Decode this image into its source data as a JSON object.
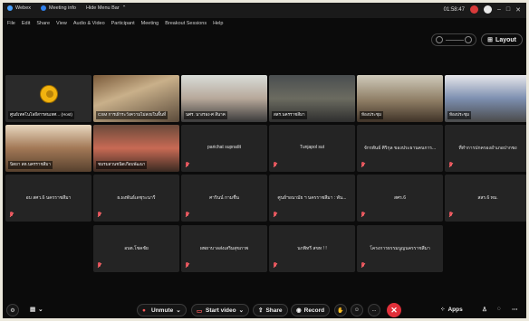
{
  "titlebar": {
    "app": "Webex",
    "meeting_info": "Meeting info",
    "hide_menu": "Hide Menu Bar",
    "timer": "01:58:47"
  },
  "menu": [
    "File",
    "Edit",
    "Share",
    "View",
    "Audio & Video",
    "Participant",
    "Meeting",
    "Breakout Sessions",
    "Help"
  ],
  "view": {
    "layout_label": "Layout"
  },
  "tiles": [
    {
      "label": "ศูนย์เทคโนโลยีสารสนเทศ... (Host)",
      "kind": "logo"
    },
    {
      "label": "CSM การเฝ้าระวังความไม่สงบในพื้นที่",
      "kind": "video"
    },
    {
      "label": "นศร. นางรอง-ศ สีนาค",
      "kind": "video"
    },
    {
      "label": "สสร.นครราชสีมา",
      "kind": "video"
    },
    {
      "label": "ห้องประชุม",
      "kind": "video"
    },
    {
      "label": "ห้องประชุม",
      "kind": "video"
    },
    {
      "label": "นิตยา สต.นครราชสีมา",
      "kind": "video"
    },
    {
      "label": "ชมรมสวนชนิดเกือบพัฒนา",
      "kind": "video"
    },
    {
      "label": "parichat supradit",
      "kind": "name"
    },
    {
      "label": "Tunjapol sut",
      "kind": "name"
    },
    {
      "label": "จักรพันธ์ ศิริกุล ของประธานคนการ...",
      "kind": "name"
    },
    {
      "label": "ที่ทำการปกครองอำเภอปากชง",
      "kind": "name"
    },
    {
      "label": "อบ สศว.6 นครราชสีมา",
      "kind": "name"
    },
    {
      "label": "ผ.ผงพันธ์เดชุระนารี",
      "kind": "name"
    },
    {
      "label": "ศารินน์ กามชื่น",
      "kind": "name"
    },
    {
      "label": "ศูนย์ฯอนามัย ฯ นครราชสีมา : พัน...",
      "kind": "name"
    },
    {
      "label": "สศร.6",
      "kind": "name"
    },
    {
      "label": "สสร.6 ทม.",
      "kind": "name"
    },
    {
      "label": "อบต.โชคชัย",
      "kind": "name"
    },
    {
      "label": "ผพยาบาลส่งเสริมสุขภาพ",
      "kind": "name"
    },
    {
      "label": "นกพิทรี สขท ! !",
      "kind": "name"
    },
    {
      "label": "โครงการธรรมนูญนครราชสีมา",
      "kind": "name"
    }
  ],
  "toolbar": {
    "unmute": "Unmute",
    "start_video": "Start video",
    "share": "Share",
    "record": "Record",
    "more": "...",
    "apps": "Apps"
  },
  "colors": {
    "end_button": "#e0303a",
    "mute_icon": "#e0505a",
    "background": "#0b0b0b",
    "tile": "#242424"
  }
}
